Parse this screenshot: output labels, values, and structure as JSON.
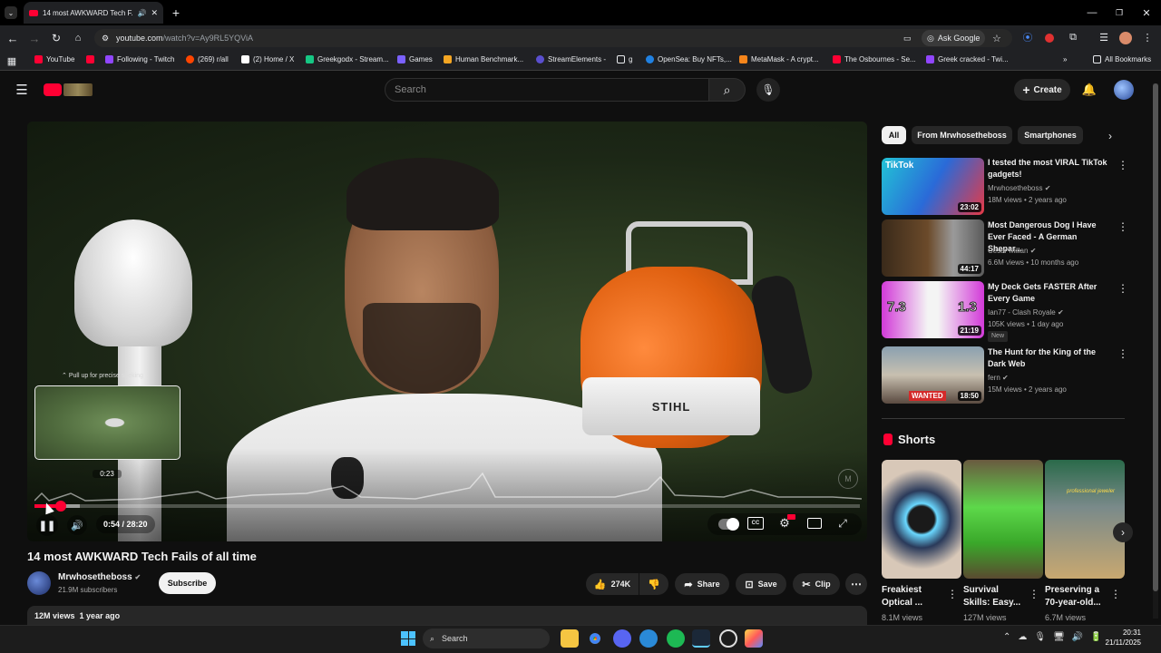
{
  "browser": {
    "tab_title": "14 most AWKWARD Tech F...",
    "url_host": "youtube.com",
    "url_path": "/watch?v=Ay9RL5YQViA",
    "ask_google": "Ask Google",
    "bookmarks": [
      "YouTube",
      "Following - Twitch",
      "(269) r/all",
      "(2) Home / X",
      "Greekgodx - Stream...",
      "Games",
      "Human Benchmark...",
      "StreamElements -",
      "g",
      "OpenSea: Buy NFTs,...",
      "MetaMask - A crypt...",
      "The Osbournes - Se...",
      "Greek cracked - Twi..."
    ],
    "all_bookmarks": "All Bookmarks"
  },
  "youtube": {
    "search_placeholder": "Search",
    "create_label": "Create"
  },
  "player": {
    "seek_hint": "Pull up for precise seeking",
    "preview_time": "0:23",
    "time_display": "0:54 / 28:20",
    "progress_fraction": 0.032,
    "watermark": "M"
  },
  "video": {
    "title": "14 most AWKWARD Tech Fails of all time",
    "channel": "Mrwhosetheboss",
    "subscribers": "21.9M subscribers",
    "subscribe_label": "Subscribe",
    "likes": "274K",
    "share_label": "Share",
    "save_label": "Save",
    "clip_label": "Clip",
    "views": "12M views",
    "age": "1 year ago",
    "logo_text": "STIHL"
  },
  "chips": [
    "All",
    "From Mrwhosetheboss",
    "Smartphones"
  ],
  "recommended": [
    {
      "title_1": "I tested the most VIRAL TikTok",
      "title_2": "gadgets!",
      "channel": "Mrwhosetheboss",
      "meta": "18M views • 2 years ago",
      "duration": "23:02",
      "thumb_text": "TikTok"
    },
    {
      "title_1": "Most Dangerous Dog I Have",
      "title_2": "Ever Faced - A German Shepar...",
      "channel": "Cesar Millan",
      "meta": "6.6M views • 10 months ago",
      "duration": "44:17"
    },
    {
      "title_1": "My Deck Gets FASTER After",
      "title_2": "Every Game",
      "channel": "Ian77 - Clash Royale",
      "meta": "105K views • 1 day ago",
      "duration": "21:19",
      "badge": "New",
      "thumb_left": "7.3",
      "thumb_right": "1.3"
    },
    {
      "title_1": "The Hunt for the King of the",
      "title_2": "Dark Web",
      "channel": "fern",
      "meta": "15M views • 2 years ago",
      "duration": "18:50",
      "thumb_text": "WANTED"
    }
  ],
  "shorts": {
    "heading": "Shorts",
    "items": [
      {
        "title_1": "Freakiest",
        "title_2": "Optical ...",
        "views": "8.1M views"
      },
      {
        "title_1": "Survival",
        "title_2": "Skills: Easy...",
        "views": "127M views"
      },
      {
        "title_1": "Preserving a",
        "title_2": "70-year-old...",
        "views": "6.7M views",
        "thumb_text": "professional jeweler"
      }
    ]
  },
  "taskbar": {
    "search_label": "Search",
    "time": "20:31",
    "date": "21/11/2025"
  }
}
